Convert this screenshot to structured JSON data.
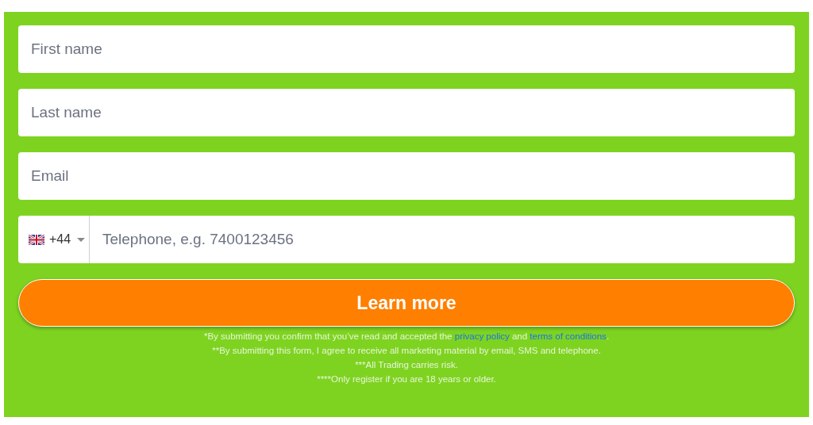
{
  "fields": [
    {
      "placeholder": "First name"
    },
    {
      "placeholder": "Last name"
    },
    {
      "placeholder": "Email"
    }
  ],
  "phone": {
    "country_code": "+44",
    "placeholder": "Telephone, e.g. 7400123456"
  },
  "submit_button": "Learn more",
  "consent": {
    "before": "*By submitting you confirm that you’ve read and accepted the",
    "privacy_link": "privacy policy",
    "middle": "and",
    "terms_link": "terms of conditions",
    "after": "."
  },
  "disclaimers": [
    "**By submitting this form, I agree to receive all marketing material by email, SMS and telephone.",
    "***All Trading carries risk.",
    "****Only register if you are 18 years or older."
  ]
}
